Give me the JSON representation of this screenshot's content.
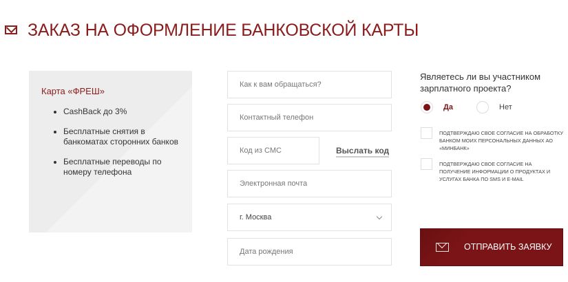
{
  "header": {
    "title": "ЗАКАЗ НА ОФОРМЛЕНИЕ БАНКОВСКОЙ КАРТЫ",
    "icon": "mail-icon"
  },
  "card": {
    "title": "Карта «ФРЕШ»",
    "features": [
      "CashBack до 3%",
      "Бесплатные снятия в банкоматах сторонних банков",
      "Бесплатные переводы по номеру телефона"
    ]
  },
  "form": {
    "name_placeholder": "Как к вам обращаться?",
    "phone_placeholder": "Контактный телефон",
    "sms_placeholder": "Код из СМС",
    "send_code": "Выслать код",
    "email_placeholder": "Электронная почта",
    "city_value": "г. Москва",
    "dob_placeholder": "Дата рождения"
  },
  "salary": {
    "question": "Являетесь ли вы участником зарплатного проекта?",
    "yes": "Да",
    "no": "Нет",
    "selected": "yes"
  },
  "consents": [
    "Подтверждаю свое согласие на обработку банком моих персональных данных АО «МИНБАНК»",
    "Подтверждаю свое согласие на получение информации о продуктах и услугах банка по SMS и E-mail"
  ],
  "submit": {
    "label": "ОТПРАВИТЬ ЗАЯВКУ",
    "icon": "mail-icon"
  },
  "colors": {
    "accent": "#7a1416",
    "card_bg": "#efefef"
  }
}
